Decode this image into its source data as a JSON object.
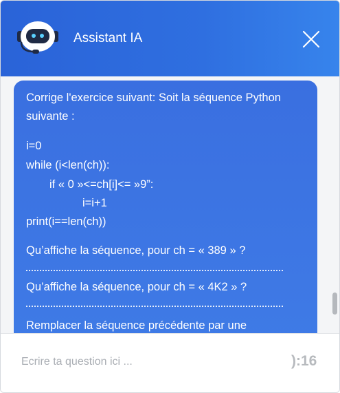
{
  "header": {
    "title": "Assistant IA"
  },
  "icons": {
    "avatar": "robot-avatar-icon",
    "close": "close-icon"
  },
  "colors": {
    "header_start": "#2a63d8",
    "header_end": "#3784ec",
    "bubble": "#3b72e2",
    "chat_bg": "#f4f5f7"
  },
  "message": {
    "lines": [
      "Corrige l'exercice suivant: Soit la séquence Python",
      "suivante :",
      "i=0",
      "while (i<len(ch)):",
      "if « 0 »<=ch[i]<= »9”:",
      "i=i+1",
      "print(i==len(ch))",
      "Qu’affiche la séquence, pour ch = « 389 » ?",
      "Qu’affiche la séquence, pour ch = « 4K2 » ?",
      "Remplacer la séquence précédente par une"
    ]
  },
  "composer": {
    "placeholder": "Ecrire ta question ici ...",
    "counter": "):16"
  }
}
